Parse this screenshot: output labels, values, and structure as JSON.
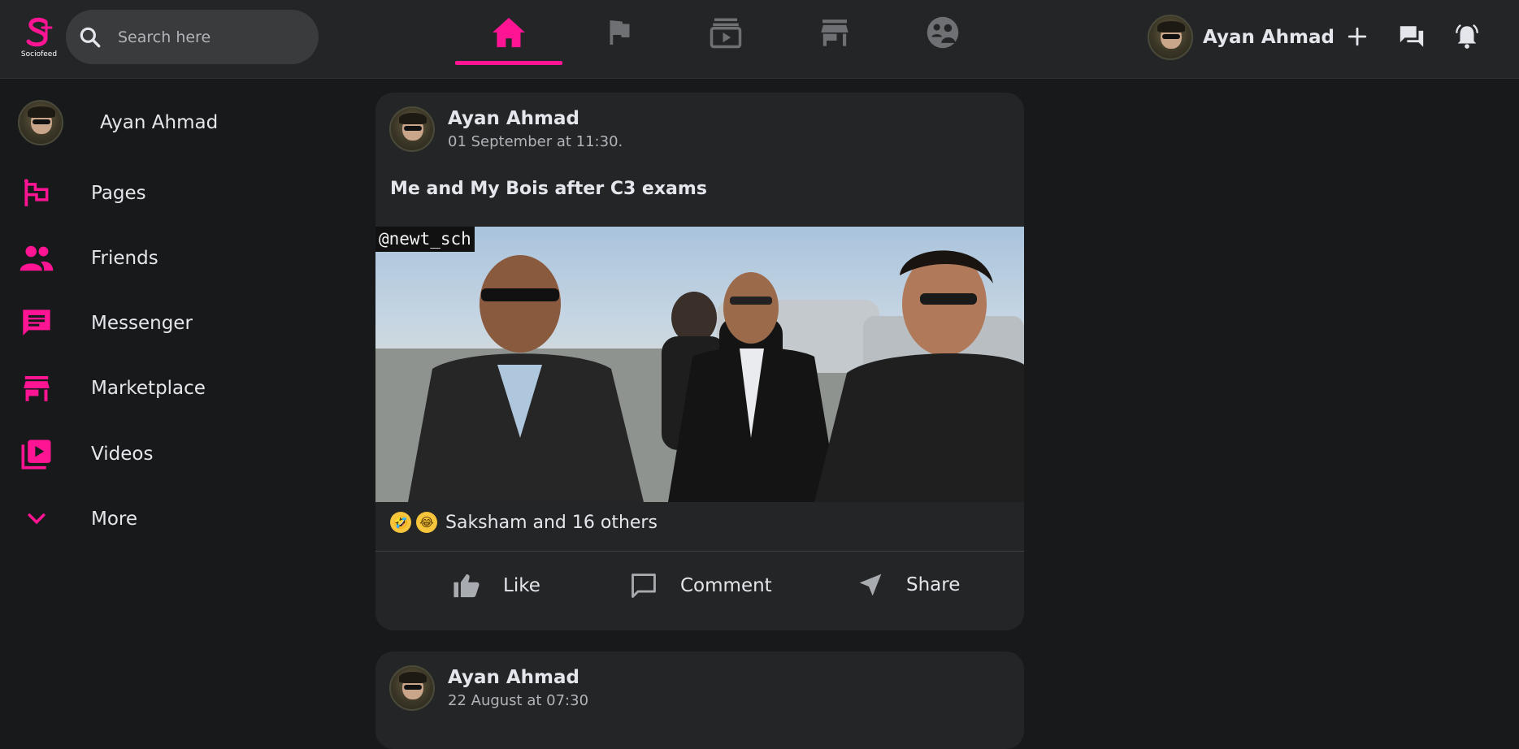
{
  "brand": {
    "logo_text": "Sociofeed",
    "accent_color": "#ff1493"
  },
  "search": {
    "placeholder": "Search here"
  },
  "nav": {
    "tabs": [
      {
        "icon": "home-icon",
        "active": true
      },
      {
        "icon": "flag-icon",
        "active": false
      },
      {
        "icon": "video-library-icon",
        "active": false
      },
      {
        "icon": "store-icon",
        "active": false
      },
      {
        "icon": "groups-icon",
        "active": false
      }
    ]
  },
  "header": {
    "user_name": "Ayan Ahmad",
    "icons": [
      "add-icon",
      "chat-icon",
      "notification-bell-icon"
    ]
  },
  "sidebar": {
    "profile_name": "Ayan Ahmad",
    "items": [
      {
        "label": "Pages",
        "icon": "pages-flag-icon"
      },
      {
        "label": "Friends",
        "icon": "people-icon"
      },
      {
        "label": "Messenger",
        "icon": "message-icon"
      },
      {
        "label": "Marketplace",
        "icon": "store-icon"
      },
      {
        "label": "Videos",
        "icon": "video-library-icon"
      },
      {
        "label": "More",
        "icon": "chevron-down-icon"
      }
    ]
  },
  "posts": [
    {
      "author": "Ayan Ahmad",
      "time": "01 September at 11:30.",
      "caption": "Me and My Bois after C3 exams",
      "image_watermark": "@newt_sch",
      "reaction_emojis": [
        "🤣",
        "😂"
      ],
      "reaction_text": "Saksham and 16 others",
      "actions": {
        "like": "Like",
        "comment": "Comment",
        "share": "Share"
      }
    },
    {
      "author": "Ayan Ahmad",
      "time": "22 August at 07:30"
    }
  ]
}
